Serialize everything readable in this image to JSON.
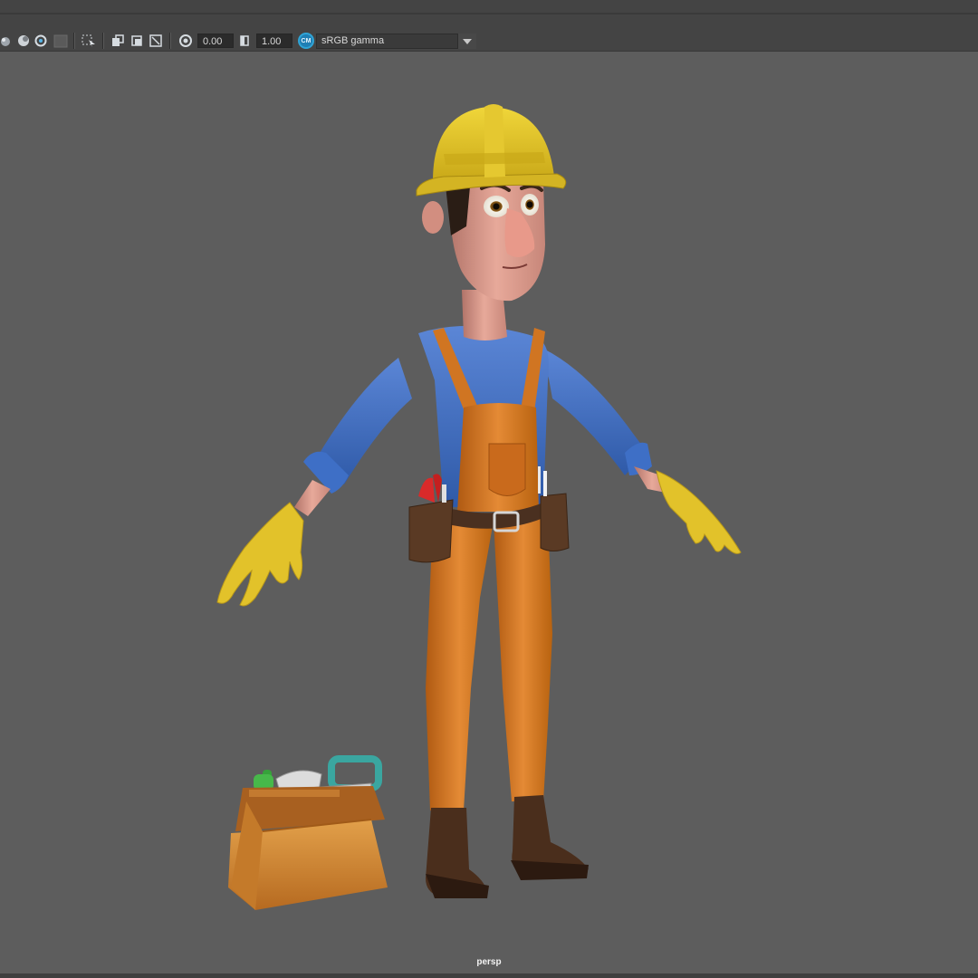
{
  "toolbar": {
    "exposure_value": "0.00",
    "gamma_value": "1.00",
    "color_management_badge": "CM",
    "color_space": "sRGB gamma",
    "icons": [
      "shaded-icon",
      "lighting-icon",
      "isolate-icon",
      "xray-icon",
      "select-camera-icon",
      "resolution-gate-icon",
      "film-gate-icon",
      "safe-action-icon",
      "exposure-icon",
      "gamma-icon",
      "chevron-down-icon"
    ]
  },
  "viewport": {
    "camera": "persp",
    "background_color": "#5d5d5d",
    "subject": "cartoon construction worker with toolbox"
  },
  "colors": {
    "helmet": "#e0c128",
    "shirt": "#3f6fc4",
    "overalls": "#d0741f",
    "gloves": "#e2c22a",
    "boots": "#4a2e1c",
    "toolbox": "#d08a35"
  }
}
